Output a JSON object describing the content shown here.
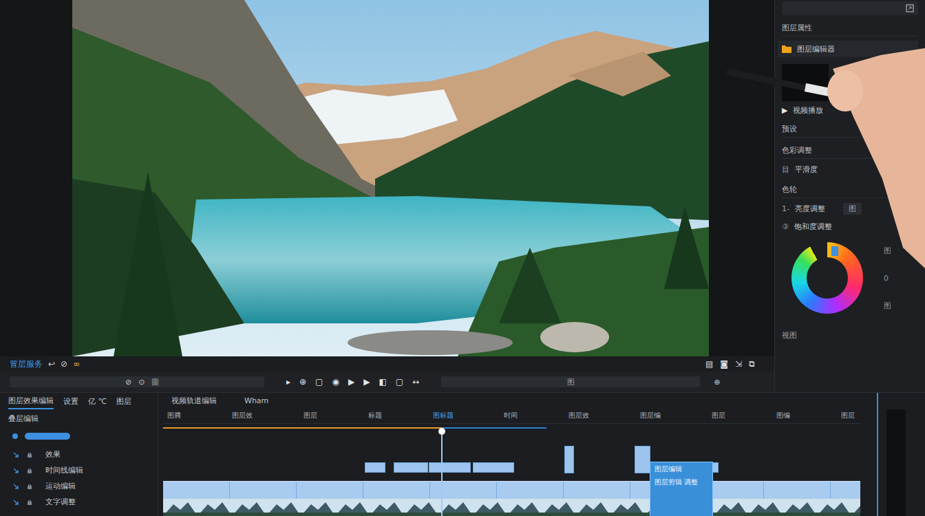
{
  "preview": {
    "caption": "冒层服务",
    "caption_icon": "↩",
    "extra_icons": [
      "⊘",
      "∞"
    ],
    "view_icons": [
      "▤",
      "◙",
      "⇲",
      "⧉"
    ]
  },
  "transport": {
    "left_icons": [
      "⊘",
      "⊙"
    ],
    "left_mark": "圖",
    "buttons": [
      "▸",
      "⊕",
      "▢",
      "◉",
      "▶",
      "▶",
      "◧",
      "▢",
      "↔"
    ],
    "right_mark": "图",
    "end_icon": "⊕"
  },
  "side_panel": {
    "items": [
      {
        "kind": "header",
        "label": "图层属性"
      },
      {
        "kind": "file",
        "label": "图层编辑器"
      },
      {
        "kind": "thumb",
        "icon": "▶",
        "label": "视频播放"
      },
      {
        "kind": "header",
        "label": "预设"
      },
      {
        "kind": "header",
        "label": "色彩调整"
      },
      {
        "kind": "row",
        "icon": "目",
        "label": "平滑度"
      },
      {
        "kind": "header",
        "label": "色轮"
      },
      {
        "kind": "field",
        "icon": "1-",
        "label": "亮度调整",
        "value": "图"
      },
      {
        "kind": "row",
        "icon": "③",
        "label": "饱和度调整"
      }
    ],
    "wheel": {
      "level": 0.92,
      "marks": [
        "图",
        "0",
        "图"
      ]
    },
    "footer": "视图"
  },
  "timeline": {
    "panel_tabs": [
      {
        "label": "图层效果编辑",
        "selected": true
      },
      {
        "label": "设置",
        "selected": false
      },
      {
        "label": "亿 ℃",
        "selected": false
      },
      {
        "label": "图层",
        "selected": false
      }
    ],
    "layers_title": "叠层编辑",
    "layers": [
      {
        "kind": "pill",
        "label": "",
        "selected": true
      },
      {
        "kind": "row",
        "label": "效果",
        "selected": false
      },
      {
        "kind": "row",
        "label": "时间线编辑",
        "selected": false
      },
      {
        "kind": "row",
        "label": "运动编辑",
        "selected": false
      },
      {
        "kind": "row",
        "label": "文字调整",
        "selected": false
      }
    ],
    "track_title": "视频轨道编辑",
    "track_mode": "Wham",
    "ruler": [
      {
        "label": "图腾",
        "selected": false
      },
      {
        "label": "图层效",
        "selected": false
      },
      {
        "label": "图层",
        "selected": false
      },
      {
        "label": "标题",
        "selected": false
      },
      {
        "label": "图标题",
        "selected": true
      },
      {
        "label": "时间",
        "selected": false
      },
      {
        "label": "图层效",
        "selected": false
      },
      {
        "label": "图层编",
        "selected": false
      },
      {
        "label": "图层",
        "selected": false
      },
      {
        "label": "图编",
        "selected": false
      },
      {
        "label": "图层",
        "selected": false
      }
    ],
    "playhead": 0.4,
    "progress": 0.4,
    "buffered": 0.55,
    "clips": [
      {
        "start": 0.289,
        "end": 0.319,
        "tall": false
      },
      {
        "start": 0.331,
        "end": 0.38,
        "tall": false
      },
      {
        "start": 0.381,
        "end": 0.441,
        "tall": false
      },
      {
        "start": 0.444,
        "end": 0.503,
        "tall": false
      },
      {
        "start": 0.576,
        "end": 0.589,
        "tall": true
      },
      {
        "start": 0.676,
        "end": 0.699,
        "tall": true
      },
      {
        "start": 0.788,
        "end": 0.797,
        "tall": false
      }
    ],
    "selected_clip": {
      "start": 0.699,
      "end": 0.788,
      "title": "图层编辑",
      "subtitle": "图层剪辑 调整",
      "selected": true
    }
  }
}
